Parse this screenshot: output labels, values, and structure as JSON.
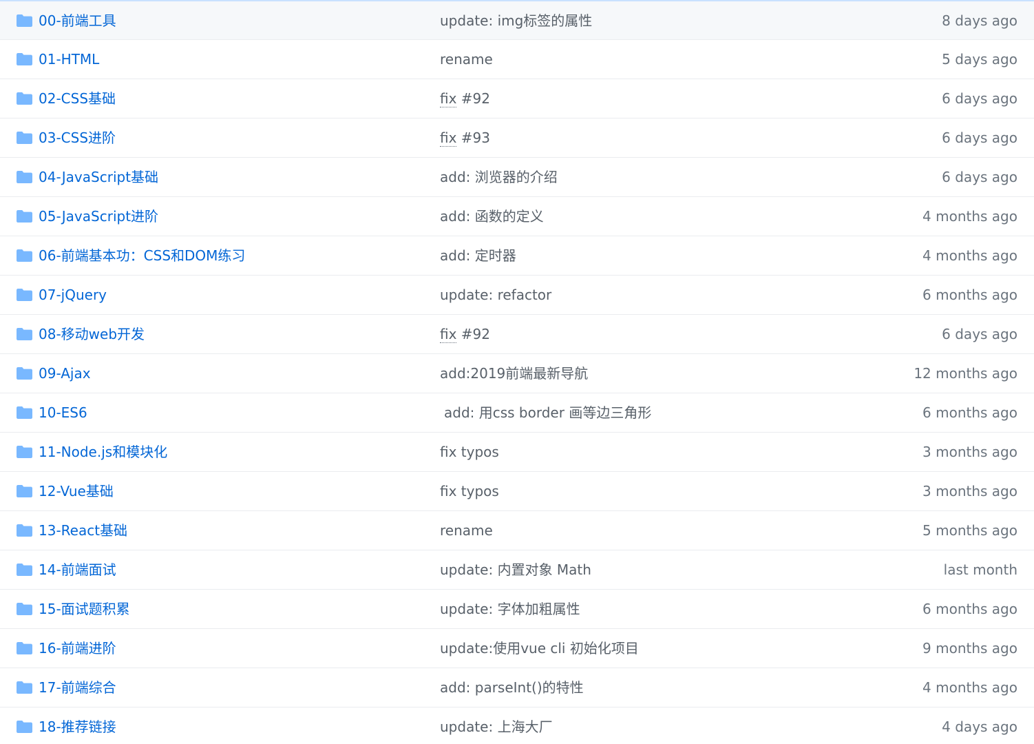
{
  "colors": {
    "link": "#0366d6",
    "folder_icon": "#79b8ff",
    "text": "#586069",
    "muted": "#6a737d",
    "border": "#eaecef",
    "header_highlight": "#c8e1ff"
  },
  "rows": [
    {
      "icon": "folder-icon",
      "name": "00-前端工具",
      "commit": "update: img标签的属性",
      "age": "8 days ago"
    },
    {
      "icon": "folder-icon",
      "name": "01-HTML",
      "commit": "rename",
      "age": "5 days ago"
    },
    {
      "icon": "folder-icon",
      "name": "02-CSS基础",
      "commit_kw": "fix",
      "commit_rest": " #92",
      "age": "6 days ago"
    },
    {
      "icon": "folder-icon",
      "name": "03-CSS进阶",
      "commit_kw": "fix",
      "commit_rest": " #93",
      "age": "6 days ago"
    },
    {
      "icon": "folder-icon",
      "name": "04-JavaScript基础",
      "commit": "add: 浏览器的介绍",
      "age": "6 days ago"
    },
    {
      "icon": "folder-icon",
      "name": "05-JavaScript进阶",
      "commit": "add: 函数的定义",
      "age": "4 months ago"
    },
    {
      "icon": "folder-icon",
      "name": "06-前端基本功：CSS和DOM练习",
      "commit": "add: 定时器",
      "age": "4 months ago"
    },
    {
      "icon": "folder-icon",
      "name": "07-jQuery",
      "commit": "update: refactor",
      "age": "6 months ago"
    },
    {
      "icon": "folder-icon",
      "name": "08-移动web开发",
      "commit_kw": "fix",
      "commit_rest": " #92",
      "age": "6 days ago"
    },
    {
      "icon": "folder-icon",
      "name": "09-Ajax",
      "commit": "add:2019前端最新导航",
      "age": "12 months ago"
    },
    {
      "icon": "folder-icon",
      "name": "10-ES6",
      "commit": "add: 用css border 画等边三角形",
      "age": "6 months ago"
    },
    {
      "icon": "folder-icon",
      "name": "11-Node.js和模块化",
      "commit": "fix typos",
      "age": "3 months ago"
    },
    {
      "icon": "folder-icon",
      "name": "12-Vue基础",
      "commit": "fix typos",
      "age": "3 months ago"
    },
    {
      "icon": "folder-icon",
      "name": "13-React基础",
      "commit": "rename",
      "age": "5 months ago"
    },
    {
      "icon": "folder-icon",
      "name": "14-前端面试",
      "commit": "update: 内置对象 Math",
      "age": "last month"
    },
    {
      "icon": "folder-icon",
      "name": "15-面试题积累",
      "commit": "update: 字体加粗属性",
      "age": "6 months ago"
    },
    {
      "icon": "folder-icon",
      "name": "16-前端进阶",
      "commit": "update:使用vue cli 初始化项目",
      "age": "9 months ago"
    },
    {
      "icon": "folder-icon",
      "name": "17-前端综合",
      "commit": "add: parseInt()的特性",
      "age": "4 months ago"
    },
    {
      "icon": "folder-icon",
      "name": "18-推荐链接",
      "commit": "update: 上海大厂",
      "age": "4 days ago"
    }
  ]
}
